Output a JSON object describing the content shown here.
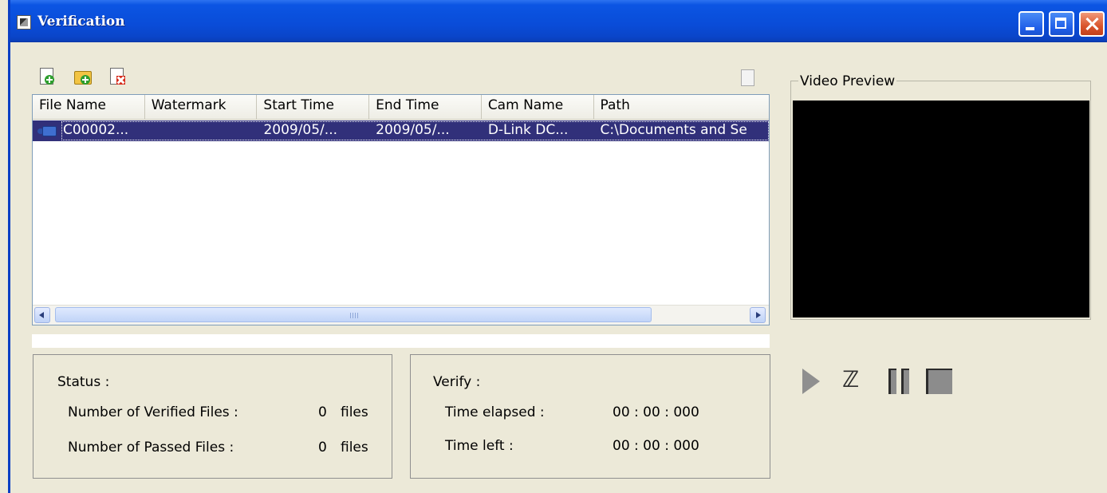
{
  "window": {
    "title": "Verification"
  },
  "toolbar": {
    "add_icon": "add-file-icon",
    "folder_icon": "add-folder-icon",
    "remove_icon": "remove-file-icon",
    "export_icon": "export-icon"
  },
  "file_list": {
    "columns": [
      "File Name",
      "Watermark",
      "Start Time",
      "End Time",
      "Cam Name",
      "Path"
    ],
    "rows": [
      {
        "file_name": "C00002...",
        "watermark": "",
        "start_time": "2009/05/...",
        "end_time": "2009/05/...",
        "cam_name": "D-Link DC...",
        "path": "C:\\Documents and Se",
        "selected": true
      }
    ],
    "scrollbar_grip": "IIII"
  },
  "progress": {
    "percent": 0
  },
  "status": {
    "heading": "Status :",
    "verified_label": "Number of Verified Files :",
    "verified_value": "0",
    "verified_unit": "files",
    "passed_label": "Number of Passed Files :",
    "passed_value": "0",
    "passed_unit": "files"
  },
  "verify": {
    "heading": "Verify :",
    "elapsed_label": "Time elapsed :",
    "elapsed_value": "00 : 00 : 000",
    "left_label": "Time left :",
    "left_value": "00 : 00 : 000"
  },
  "video": {
    "legend": "Video Preview"
  },
  "colors": {
    "titlebar": "#0a4cd8",
    "selection": "#31307a",
    "window_bg": "#ece9d8",
    "preview_bg": "#000000"
  }
}
